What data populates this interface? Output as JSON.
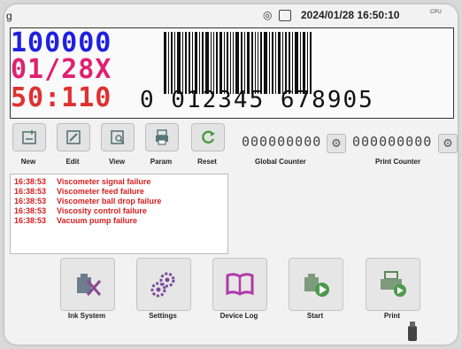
{
  "status": {
    "app_name": "g",
    "datetime": "2024/01/28 16:50:10",
    "cpu_label": "CPU"
  },
  "preview": {
    "line1": "100000",
    "line2": "01/28X",
    "line3": "50:110",
    "barcode_text": "0 012345 678905",
    "colors": {
      "line1": "#2020e0",
      "line2": "#e02070",
      "line3": "#e03030"
    }
  },
  "toolbar": {
    "new": "New",
    "edit": "Edit",
    "view": "View",
    "param": "Param",
    "reset": "Reset"
  },
  "counters": {
    "global_value": "000000000",
    "global_label": "Global Counter",
    "print_value": "000000000",
    "print_label": "Print Counter"
  },
  "log": [
    {
      "time": "16:38:53",
      "message": "Viscometer signal failure"
    },
    {
      "time": "16:38:53",
      "message": "Viscometer feed failure"
    },
    {
      "time": "16:38:53",
      "message": "Viscometer ball drop failure"
    },
    {
      "time": "16:38:53",
      "message": "Viscosity control failure"
    },
    {
      "time": "16:38:53",
      "message": "Vacuum pump failure"
    }
  ],
  "actions": {
    "ink_system": "Ink System",
    "settings": "Settings",
    "device_log": "Device Log",
    "start": "Start",
    "print": "Print"
  }
}
